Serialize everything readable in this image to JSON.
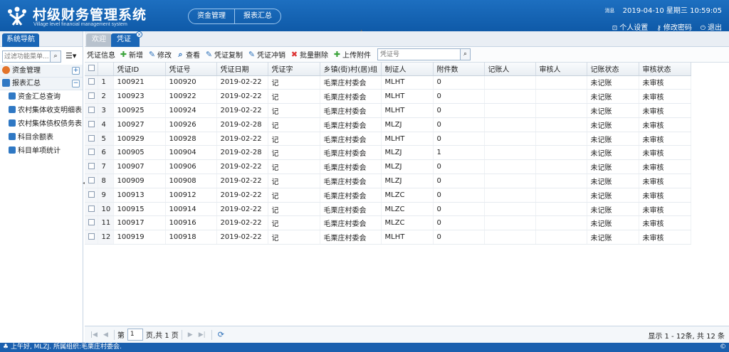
{
  "app": {
    "title": "村级财务管理系统",
    "subtitle": "Village level financial management system"
  },
  "top_nav": {
    "items": [
      "资金管理",
      "报表汇总"
    ]
  },
  "header": {
    "msg_label": "消息",
    "datetime": "2019-04-10 星期三 10:59:05",
    "links": [
      "个人设置",
      "修改密码",
      "退出"
    ]
  },
  "left": {
    "tab_label": "系统导航",
    "filter_placeholder": "过滤功能菜单...",
    "groups": [
      {
        "label": "资金管理",
        "toggle": "+",
        "items": []
      },
      {
        "label": "报表汇总",
        "toggle": "−",
        "items": [
          "资金汇总查询",
          "农村集体收支明细表",
          "农村集体债权债务表",
          "科目余额表",
          "科目单项统计"
        ]
      }
    ]
  },
  "tabs": {
    "welcome": "欢迎",
    "voucher": "凭证"
  },
  "toolbar": {
    "title": "凭证信息",
    "buttons": [
      "新增",
      "修改",
      "查看",
      "凭证复制",
      "凭证冲销",
      "批量删除",
      "上传附件"
    ],
    "search_placeholder": "凭证号"
  },
  "grid": {
    "columns": [
      "凭证ID",
      "凭证号",
      "凭证日期",
      "凭证字",
      "乡镇(街)村(居)组",
      "制证人",
      "附件数",
      "记账人",
      "审核人",
      "记账状态",
      "审核状态"
    ],
    "rows": [
      [
        "1",
        "100921",
        "100920",
        "2019-02-22",
        "记",
        "毛栗庄村委会",
        "MLHT",
        "0",
        "",
        "",
        "未记账",
        "未审核"
      ],
      [
        "2",
        "100923",
        "100922",
        "2019-02-22",
        "记",
        "毛栗庄村委会",
        "MLHT",
        "0",
        "",
        "",
        "未记账",
        "未审核"
      ],
      [
        "3",
        "100925",
        "100924",
        "2019-02-22",
        "记",
        "毛栗庄村委会",
        "MLHT",
        "0",
        "",
        "",
        "未记账",
        "未审核"
      ],
      [
        "4",
        "100927",
        "100926",
        "2019-02-28",
        "记",
        "毛栗庄村委会",
        "MLZJ",
        "0",
        "",
        "",
        "未记账",
        "未审核"
      ],
      [
        "5",
        "100929",
        "100928",
        "2019-02-22",
        "记",
        "毛栗庄村委会",
        "MLHT",
        "0",
        "",
        "",
        "未记账",
        "未审核"
      ],
      [
        "6",
        "100905",
        "100904",
        "2019-02-28",
        "记",
        "毛栗庄村委会",
        "MLZJ",
        "1",
        "",
        "",
        "未记账",
        "未审核"
      ],
      [
        "7",
        "100907",
        "100906",
        "2019-02-22",
        "记",
        "毛栗庄村委会",
        "MLZJ",
        "0",
        "",
        "",
        "未记账",
        "未审核"
      ],
      [
        "8",
        "100909",
        "100908",
        "2019-02-22",
        "记",
        "毛栗庄村委会",
        "MLZJ",
        "0",
        "",
        "",
        "未记账",
        "未审核"
      ],
      [
        "9",
        "100913",
        "100912",
        "2019-02-22",
        "记",
        "毛栗庄村委会",
        "MLZC",
        "0",
        "",
        "",
        "未记账",
        "未审核"
      ],
      [
        "10",
        "100915",
        "100914",
        "2019-02-22",
        "记",
        "毛栗庄村委会",
        "MLZC",
        "0",
        "",
        "",
        "未记账",
        "未审核"
      ],
      [
        "11",
        "100917",
        "100916",
        "2019-02-22",
        "记",
        "毛栗庄村委会",
        "MLZC",
        "0",
        "",
        "",
        "未记账",
        "未审核"
      ],
      [
        "12",
        "100919",
        "100918",
        "2019-02-22",
        "记",
        "毛栗庄村委会",
        "MLHT",
        "0",
        "",
        "",
        "未记账",
        "未审核"
      ]
    ]
  },
  "pager": {
    "page_prefix": "第",
    "page_value": "1",
    "page_suffix": "页,共 1 页",
    "summary": "显示 1 - 12条, 共 12 条"
  },
  "status_bar": {
    "text": "上午好, MLZJ. 所属组织:毛栗庄村委会.",
    "right_icon": "©"
  }
}
